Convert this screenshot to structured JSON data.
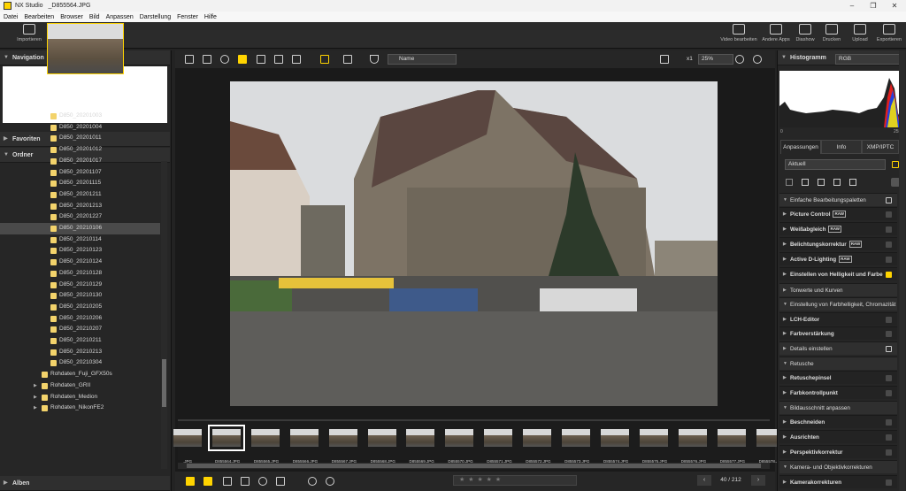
{
  "window": {
    "app_name": "NX Studio",
    "file_title": "_D855564.JPG"
  },
  "menu": [
    "Datei",
    "Bearbeiten",
    "Browser",
    "Bild",
    "Anpassen",
    "Darstellung",
    "Fenster",
    "Hilfe"
  ],
  "toolbar": {
    "import_label": "Importieren",
    "right_items": [
      "Video bearbeiten",
      "Andere Apps",
      "Diashow",
      "Drucken",
      "Upload",
      "Exportieren"
    ]
  },
  "left_panel": {
    "navigation_title": "Navigation",
    "favorites_title": "Favoriten",
    "folders_title": "Ordner",
    "albums_title": "Alben",
    "folders": [
      "D850_20201003",
      "D850_20201004",
      "D850_20201011",
      "D850_20201012",
      "D850_20201017",
      "D850_20201107",
      "D850_20201115",
      "D850_20201211",
      "D850_20201213",
      "D850_20201227",
      "D850_20210106",
      "D850_20210114",
      "D850_20210123",
      "D850_20210124",
      "D850_20210128",
      "D850_20210129",
      "D850_20210130",
      "D850_20210205",
      "D850_20210206",
      "D850_20210207",
      "D850_20210211",
      "D850_20210213",
      "D850_20210304"
    ],
    "selected_folder": "D850_20210106",
    "subfolders": [
      "Rohdaten_Fuji_GFX50s",
      "Rohdaten_GRII",
      "Rohdaten_Medion",
      "Rohdaten_NikonFE2"
    ]
  },
  "viewbar": {
    "sort_label": "Name",
    "zoom_level": "25%",
    "zoom_x": "x1"
  },
  "filmstrip": {
    "labels": [
      ".JPG",
      "_D855564.JPG",
      "_D855565.JPG",
      "_D855566.JPG",
      "_D855567.JPG",
      "_D855568.JPG",
      "_D855569.JPG",
      "_D855570.JPG",
      "_D855571.JPG",
      "_D855572.JPG",
      "_D855573.JPG",
      "_D855574.JPG",
      "_D855575.JPG",
      "_D855576.JPG",
      "_D855577.JPG",
      "_D855578.JPG"
    ],
    "current_index": 1
  },
  "bottombar": {
    "page_count": "40 / 212",
    "stars": "★ ★ ★ ★ ★"
  },
  "right_panel": {
    "histogram_title": "Histogramm",
    "histogram_channel": "RGB",
    "histogram_min": "0",
    "histogram_max": "255",
    "tabs": [
      "Anpassungen",
      "Info",
      "XMP/IPTC"
    ],
    "preset": "Aktuell",
    "rows": [
      {
        "type": "sec",
        "label": "Einfache Bearbeitungspaletten",
        "cb": "chk"
      },
      {
        "type": "item",
        "label": "Picture Control",
        "badge": "RAW",
        "cb": "off"
      },
      {
        "type": "item",
        "label": "Weißabgleich",
        "badge": "RAW",
        "cb": "off"
      },
      {
        "type": "item",
        "label": "Belichtungskorrektur",
        "badge": "RAW",
        "cb": "off"
      },
      {
        "type": "item",
        "label": "Active D-Lighting",
        "badge": "RAW",
        "cb": "off"
      },
      {
        "type": "item",
        "label": "Einstellen von Helligkeit und Farbe",
        "badge": "",
        "cb": "on"
      },
      {
        "type": "sec",
        "label": "Tonwerte und Kurven",
        "cb": "none"
      },
      {
        "type": "sec",
        "label": "Einstellung von Farbhelligkeit, Chromazität",
        "cb": "none"
      },
      {
        "type": "item",
        "label": "LCH-Editor",
        "badge": "",
        "cb": "off"
      },
      {
        "type": "item",
        "label": "Farbverstärkung",
        "badge": "",
        "cb": "off"
      },
      {
        "type": "sec",
        "label": "Details einstellen",
        "cb": "chk"
      },
      {
        "type": "sec",
        "label": "Retusche",
        "cb": "none"
      },
      {
        "type": "item",
        "label": "Retuschepinsel",
        "badge": "",
        "cb": "off"
      },
      {
        "type": "item",
        "label": "Farbkontrollpunkt",
        "badge": "",
        "cb": "off"
      },
      {
        "type": "sec",
        "label": "Bildausschnitt anpassen",
        "cb": "none"
      },
      {
        "type": "item",
        "label": "Beschneiden",
        "badge": "",
        "cb": "off"
      },
      {
        "type": "item",
        "label": "Ausrichten",
        "badge": "",
        "cb": "off"
      },
      {
        "type": "item",
        "label": "Perspektivkorrektur",
        "badge": "",
        "cb": "off"
      },
      {
        "type": "sec",
        "label": "Kamera- und Objektivkorrekturen",
        "cb": "none"
      },
      {
        "type": "item",
        "label": "Kamerakorrekturen",
        "badge": "",
        "cb": "off"
      }
    ]
  },
  "colors": {
    "accent": "#ffd400",
    "panel_bg": "#262626",
    "center_bg": "#1a1a1a"
  }
}
